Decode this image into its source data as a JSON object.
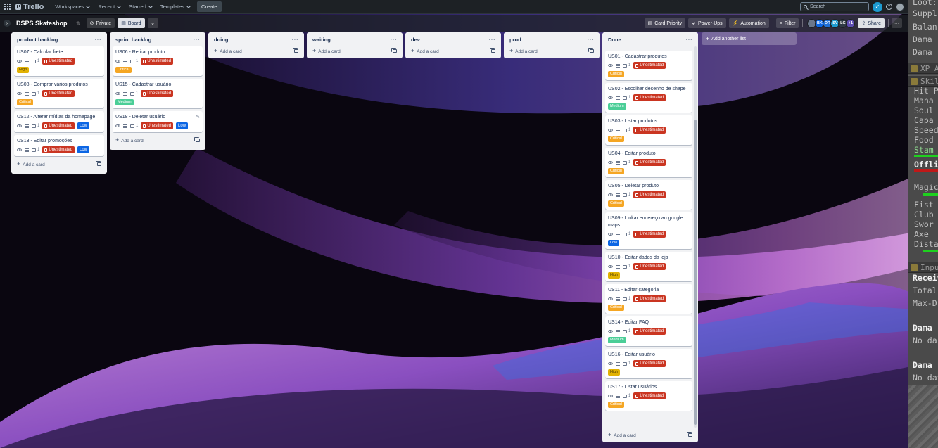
{
  "topnav": {
    "brand": "Trello",
    "menus": [
      "Workspaces",
      "Recent",
      "Starred",
      "Templates"
    ],
    "create": "Create",
    "search_placeholder": "Search"
  },
  "board": {
    "title": "DSPS Skateshop",
    "visibility": "Private",
    "view": "Board",
    "actions": [
      "Card Priority",
      "Power-Ups",
      "Automation",
      "Filter"
    ],
    "members": [
      {
        "initials": "",
        "color": "#6b778c"
      },
      {
        "initials": "BK",
        "color": "#0c66e4"
      },
      {
        "initials": "DR",
        "color": "#1f6fd6"
      },
      {
        "initials": "SV",
        "color": "#1d9bd1"
      },
      {
        "initials": "LG",
        "color": "#2f3a44"
      }
    ],
    "more_members": "+1",
    "share": "Share",
    "add_list": "Add another list"
  },
  "lists": {
    "product_backlog": {
      "title": "product backlog",
      "add": "Add a card",
      "cards": [
        {
          "title": "US07 - Calcular frete",
          "comments": "1",
          "estimate": "Unestimated",
          "priority": "High",
          "pclass": "high"
        },
        {
          "title": "US08 - Comprar vários produtos",
          "comments": "1",
          "estimate": "Unestimated",
          "priority": "Critical",
          "pclass": "critical"
        },
        {
          "title": "US12 - Alterar mídias da homepage",
          "comments": "1",
          "estimate": "Unestimated",
          "priority": "Low",
          "pclass": "low"
        },
        {
          "title": "US13 - Editar promoções",
          "comments": "1",
          "estimate": "Unestimated",
          "priority": "Low",
          "pclass": "low"
        }
      ]
    },
    "sprint_backlog": {
      "title": "sprint backlog",
      "add": "Add a card",
      "cards": [
        {
          "title": "US06 - Retirar produto",
          "comments": "1",
          "estimate": "Unestimated",
          "priority": "Critical",
          "pclass": "critical"
        },
        {
          "title": "US15 - Cadastrar usuário",
          "comments": "1",
          "estimate": "Unestimated",
          "priority": "Medium",
          "pclass": "medium"
        },
        {
          "title": "US18 - Deletar usuário",
          "comments": "1",
          "estimate": "Unestimated",
          "priority": "Low",
          "pclass": "low"
        }
      ]
    },
    "doing": {
      "title": "doing",
      "add": "Add a card"
    },
    "waiting": {
      "title": "waiting",
      "add": "Add a card"
    },
    "dev": {
      "title": "dev",
      "add": "Add a card"
    },
    "prod": {
      "title": "prod",
      "add": "Add a card"
    },
    "done": {
      "title": "Done",
      "add": "Add a card",
      "cards": [
        {
          "title": "US01 - Cadastrar produtos",
          "comments": "1",
          "estimate": "Unestimated",
          "priority": "Critical",
          "pclass": "critical"
        },
        {
          "title": "US02 - Escolher desenho de shape",
          "comments": "1",
          "estimate": "Unestimated",
          "priority": "Medium",
          "pclass": "medium"
        },
        {
          "title": "US03 - Listar produtos",
          "comments": "1",
          "estimate": "Unestimated",
          "priority": "Critical",
          "pclass": "critical"
        },
        {
          "title": "US04 - Editar produto",
          "comments": "1",
          "estimate": "Unestimated",
          "priority": "Critical",
          "pclass": "critical"
        },
        {
          "title": "US05 - Deletar produto",
          "comments": "1",
          "estimate": "Unestimated",
          "priority": "Critical",
          "pclass": "critical"
        },
        {
          "title": "US09 - Linkar endereço ao google maps",
          "comments": "1",
          "estimate": "Unestimated",
          "priority": "Low",
          "pclass": "low"
        },
        {
          "title": "US10 - Editar dados da loja",
          "comments": "1",
          "estimate": "Unestimated",
          "priority": "High",
          "pclass": "high"
        },
        {
          "title": "US11 - Editar categoria",
          "comments": "1",
          "estimate": "Unestimated",
          "priority": "Critical",
          "pclass": "critical"
        },
        {
          "title": "US14 - Editar FAQ",
          "comments": "1",
          "estimate": "Unestimated",
          "priority": "Medium",
          "pclass": "medium"
        },
        {
          "title": "US16 - Editar usuário",
          "comments": "1",
          "estimate": "Unestimated",
          "priority": "High",
          "pclass": "high"
        },
        {
          "title": "US17 - Listar usuários",
          "comments": "1",
          "estimate": "Unestimated",
          "priority": "Critical",
          "pclass": "critical"
        }
      ]
    }
  },
  "overlay": {
    "rows": [
      "Loot:",
      "Suppl",
      "Balan",
      "Dama",
      "Dama"
    ],
    "xp_header": "XP A",
    "skills_header": "Skil",
    "skills": [
      "Hit P",
      "Mana",
      "Soul",
      "Capa",
      "Speed",
      "Food",
      "Stam"
    ],
    "offline": "Offlin",
    "magic": "Magic",
    "combat": [
      "Fist",
      "Club",
      "Swor",
      "Axe",
      "Dista"
    ],
    "input_header": "Inpu",
    "received": "Receiv",
    "total": "Total:",
    "maxd": "Max-D",
    "dama1": "Dama",
    "nodata1": "No da",
    "dama2": "Dama",
    "nodata2": "No dat"
  }
}
